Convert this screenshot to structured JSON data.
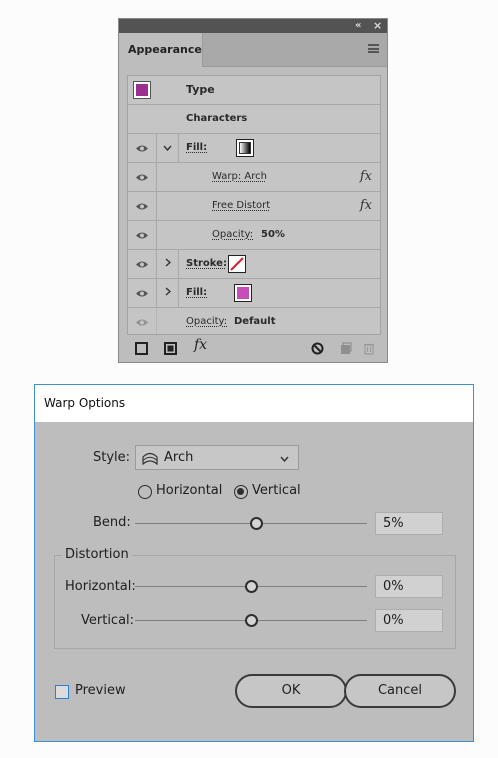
{
  "appearance_panel": {
    "collapse_glyph": "«",
    "close_glyph": "×",
    "tab_label": "Appearance",
    "rows": {
      "type": "Type",
      "characters": "Characters",
      "fill1_label": "Fill:",
      "warp": "Warp: Arch",
      "free_distort": "Free Distort",
      "opacity_label": "Opacity:",
      "opacity_value": "50%",
      "stroke_label": "Stroke:",
      "fill2_label": "Fill:",
      "opacity2_label": "Opacity:",
      "opacity2_value": "Default"
    },
    "fx_glyph": "fx",
    "colors": {
      "type_swatch": "#9b2f8f",
      "fill_swatch": "#c94db8"
    }
  },
  "warp_dialog": {
    "title": "Warp Options",
    "style_label": "Style:",
    "style_value": "Arch",
    "orientation": {
      "horizontal": "Horizontal",
      "vertical": "Vertical",
      "selected": "Vertical"
    },
    "bend_label": "Bend:",
    "bend_value": "5%",
    "distortion_label": "Distortion",
    "horizontal_label": "Horizontal:",
    "horizontal_value": "0%",
    "vertical_label": "Vertical:",
    "vertical_value": "0%",
    "preview_label": "Preview",
    "ok_label": "OK",
    "cancel_label": "Cancel"
  }
}
